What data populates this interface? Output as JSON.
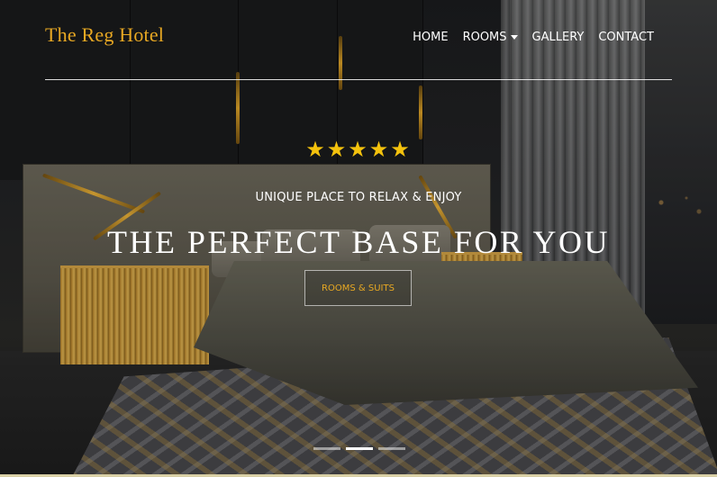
{
  "brand": {
    "name": "The Reg Hotel",
    "color": "#e8a823"
  },
  "nav": {
    "items": [
      {
        "label": "HOME"
      },
      {
        "label": "ROOMS",
        "has_dropdown": true
      },
      {
        "label": "GALLERY"
      },
      {
        "label": "CONTACT"
      }
    ]
  },
  "hero": {
    "rating_stars": "★★★★★",
    "rating": 5,
    "subtitle": "UNIQUE PLACE TO RELAX & ENJOY",
    "headline": "THE PERFECT BASE FOR YOU",
    "cta_label": "ROOMS & SUITS"
  },
  "carousel": {
    "slide_count": 3,
    "active_index": 1
  },
  "colors": {
    "accent": "#e8a823",
    "star": "#f4c20d"
  }
}
